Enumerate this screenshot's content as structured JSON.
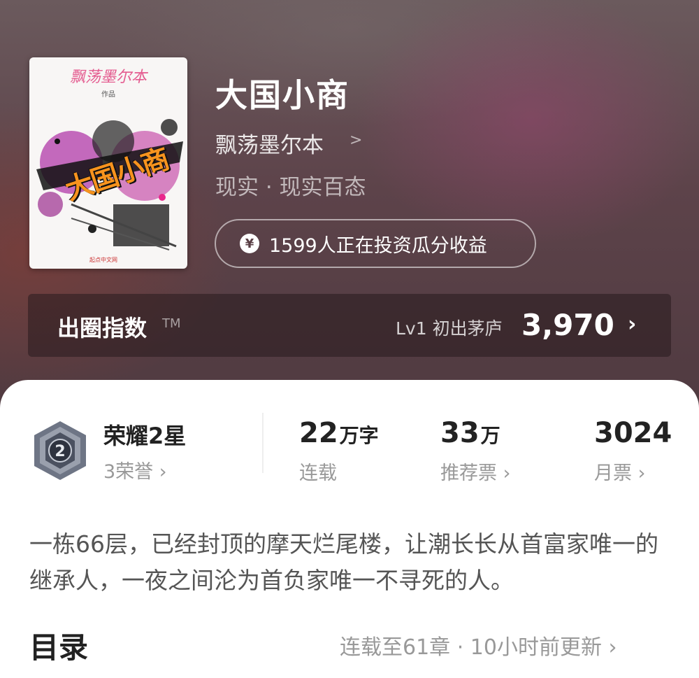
{
  "book": {
    "title": "大国小商",
    "author": "飘荡墨尔本",
    "genre": "现实 · 现实百态",
    "cover": {
      "author_script": "飘荡墨尔本",
      "zuopin": "作品",
      "title_art": "大国小商",
      "publisher": "起点中文网"
    }
  },
  "invest": {
    "text": "1599人正在投资瓜分收益",
    "icon": "yen-icon"
  },
  "index_bar": {
    "label": "出圈指数",
    "tm": "TM",
    "level": "Lv1 初出茅庐",
    "value": "3,970",
    "chevron": "›"
  },
  "honor": {
    "badge_number": "2",
    "title": "荣耀2星",
    "sub": "3荣誉 ›"
  },
  "stats": [
    {
      "number": "22",
      "unit": "万字",
      "label": "连载"
    },
    {
      "number": "33",
      "unit": "万",
      "label": "推荐票 ›"
    },
    {
      "number": "3024",
      "unit": "",
      "label": "月票 ›"
    }
  ],
  "synopsis": "一栋66层，已经封顶的摩天烂尾楼，让潮长长从首富家唯一的继承人，一夜之间沦为首负家唯一不寻死的人。",
  "toc": {
    "title": "目录",
    "status": "连载至61章 · 10小时前更新 ›"
  },
  "colors": {
    "hero_bg": "#5a3f45",
    "panel_bg": "#ffffff",
    "text_primary": "#222222",
    "text_secondary": "#999999"
  }
}
